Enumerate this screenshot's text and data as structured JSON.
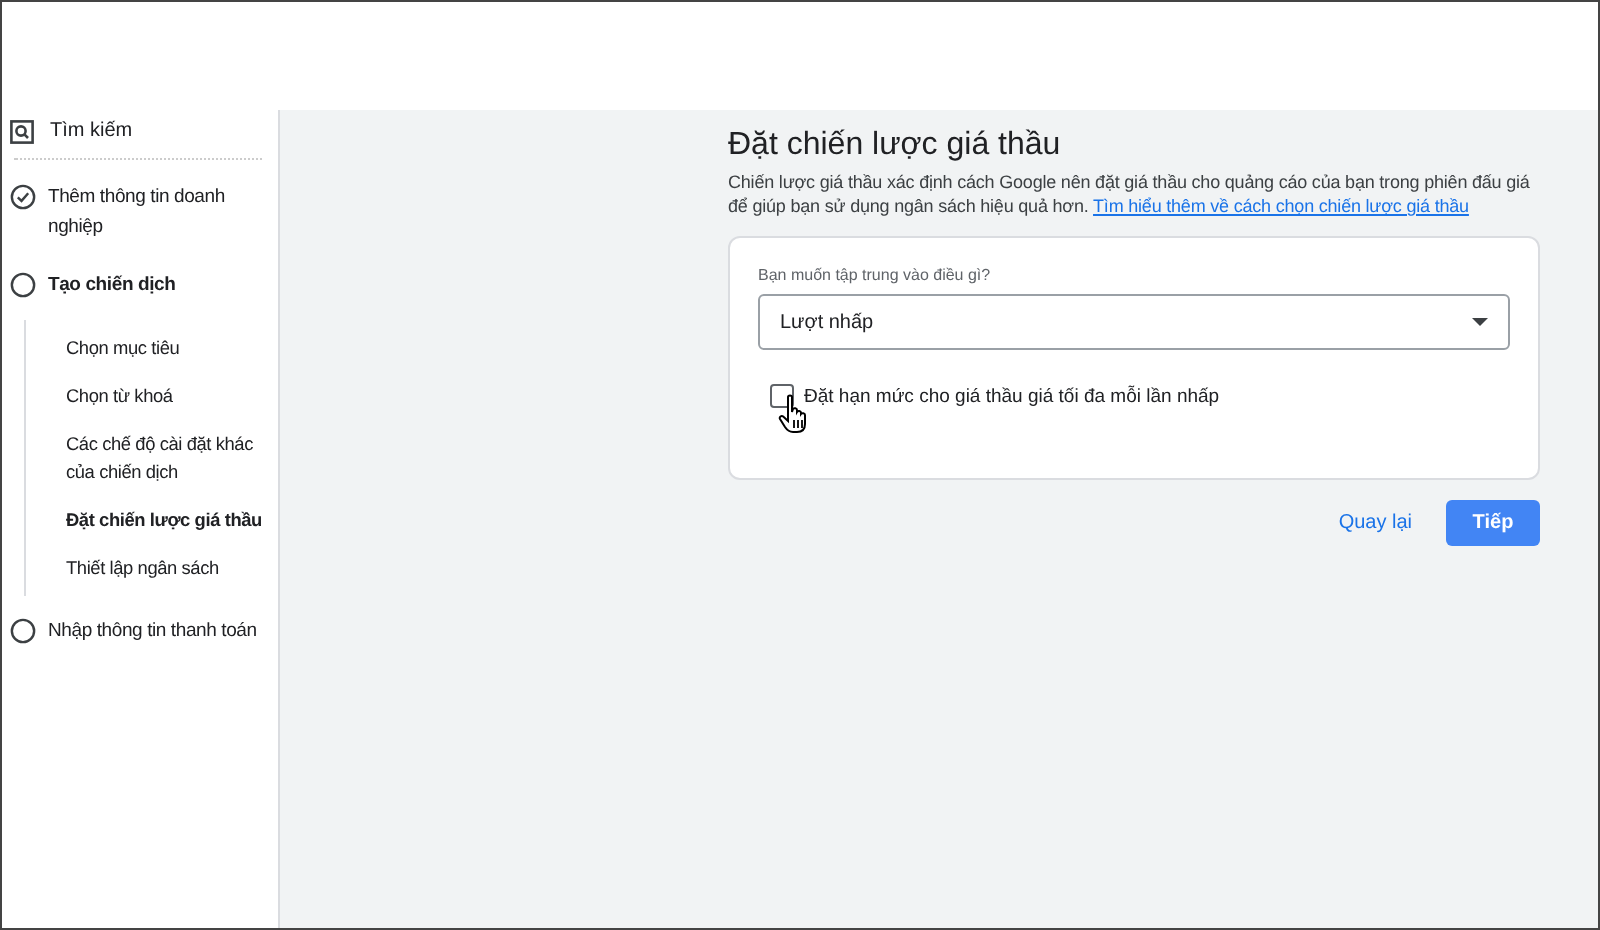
{
  "sidebar": {
    "search": {
      "label": "Tìm kiếm"
    },
    "steps": [
      {
        "label": "Thêm thông tin doanh nghiệp",
        "done": true,
        "current": false
      },
      {
        "label": "Tạo chiến dịch",
        "done": false,
        "current": true,
        "children": [
          {
            "label": "Chọn mục tiêu",
            "selected": false
          },
          {
            "label": "Chọn từ khoá",
            "selected": false
          },
          {
            "label": "Các chế độ cài đặt khác của chiến dịch",
            "selected": false
          },
          {
            "label": "Đặt chiến lược giá thầu",
            "selected": true
          },
          {
            "label": "Thiết lập ngân sách",
            "selected": false
          }
        ]
      },
      {
        "label": "Nhập thông tin thanh toán",
        "done": false,
        "current": false
      }
    ]
  },
  "main": {
    "title": "Đặt chiến lược giá thầu",
    "description": "Chiến lược giá thầu xác định cách Google nên đặt giá thầu cho quảng cáo của bạn trong phiên đấu giá để giúp bạn sử dụng ngân sách hiệu quả hơn.",
    "link": "Tìm hiểu thêm về cách chọn chiến lược giá thầu",
    "card": {
      "question": "Bạn muốn tập trung vào điều gì?",
      "select_value": "Lượt nhấp",
      "checkbox": {
        "label": "Đặt hạn mức cho giá thầu giá tối đa mỗi lần nhấp",
        "checked": false
      }
    },
    "buttons": [
      {
        "label": "Quay lại",
        "kind": "text"
      },
      {
        "label": "Tiếp",
        "kind": "primary"
      }
    ]
  }
}
